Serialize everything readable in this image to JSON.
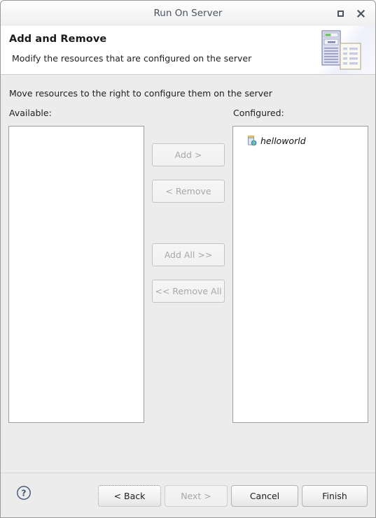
{
  "window": {
    "title": "Run On Server",
    "controls": [
      {
        "name": "maximize-button",
        "icon": "maximize-icon"
      },
      {
        "name": "close-button",
        "icon": "close-icon"
      }
    ]
  },
  "header": {
    "title": "Add and Remove",
    "subtitle": "Modify the resources that are configured on the server",
    "banner_icon": "server-and-document-icon"
  },
  "main": {
    "instruction": "Move resources to the right to configure them on the server",
    "available": {
      "label": "Available:",
      "items": []
    },
    "configured": {
      "label": "Configured:",
      "items": [
        {
          "label": "helloworld",
          "icon": "web-module-icon",
          "italic": true
        }
      ]
    },
    "transfer_buttons": [
      {
        "label": "Add >",
        "enabled": false
      },
      {
        "label": "< Remove",
        "enabled": false
      },
      {
        "label": "Add All >>",
        "enabled": false
      },
      {
        "label": "<< Remove All",
        "enabled": false
      }
    ]
  },
  "footer": {
    "help_icon": "help-question-icon",
    "buttons": [
      {
        "label": "< Back",
        "enabled": true,
        "focused": true
      },
      {
        "label": "Next >",
        "enabled": false,
        "focused": false
      },
      {
        "label": "Cancel",
        "enabled": true,
        "focused": false
      },
      {
        "label": "Finish",
        "enabled": true,
        "focused": false
      }
    ]
  },
  "colors": {
    "dialog_background": "#ececec",
    "header_background": "#ffffff",
    "list_background": "#ffffff",
    "border": "#9d9d9d",
    "title_text": "#4a5560",
    "disabled_text": "#a7a7a7"
  }
}
